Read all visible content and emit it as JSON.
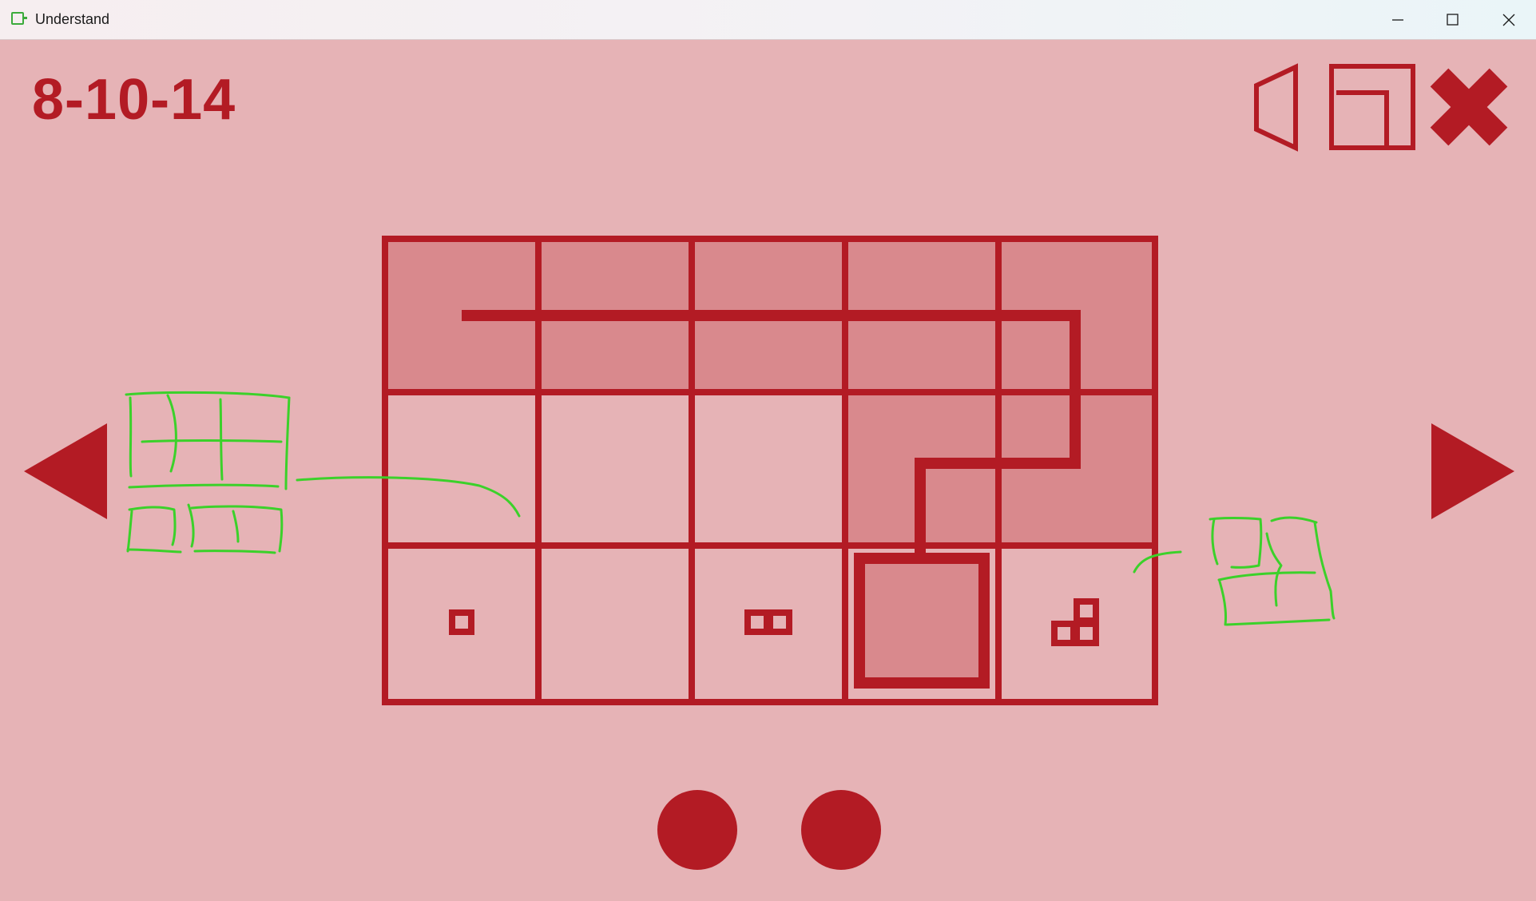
{
  "window": {
    "title": "Understand",
    "icons": [
      "app-icon",
      "minimize-icon",
      "maximize-icon",
      "close-icon"
    ]
  },
  "game": {
    "level_label": "8-10-14",
    "toolbar_icons": [
      "sound-icon",
      "fullscreen-icon",
      "exit-icon"
    ],
    "nav_icons": [
      "previous-arrow-icon",
      "next-arrow-icon"
    ],
    "page_dots": 2,
    "colors": {
      "background": "#e6b3b6",
      "accent": "#b31b24",
      "filled_cell": "#d9898d",
      "annotation": "#3bd12a"
    },
    "grid": {
      "rows": 3,
      "cols": 5,
      "filled_cells": [
        [
          0,
          0
        ],
        [
          0,
          1
        ],
        [
          0,
          2
        ],
        [
          0,
          3
        ],
        [
          0,
          4
        ],
        [
          1,
          3
        ],
        [
          1,
          4
        ]
      ],
      "cell_marks": [
        {
          "row": 2,
          "col": 0,
          "mark": "one-square"
        },
        {
          "row": 2,
          "col": 2,
          "mark": "two-squares"
        },
        {
          "row": 2,
          "col": 3,
          "mark": "goal-box"
        },
        {
          "row": 2,
          "col": 4,
          "mark": "three-squares-l"
        }
      ]
    }
  }
}
